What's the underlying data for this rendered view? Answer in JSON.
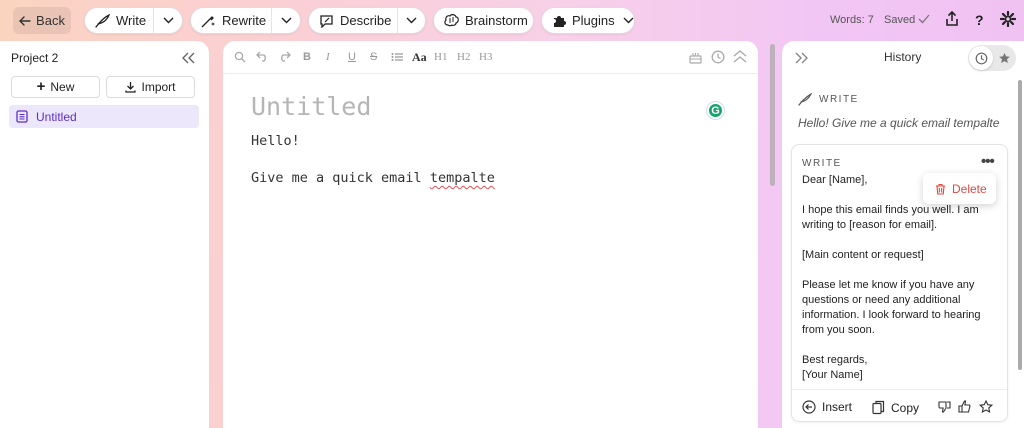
{
  "topbar": {
    "back_label": "Back",
    "write_label": "Write",
    "rewrite_label": "Rewrite",
    "describe_label": "Describe",
    "brainstorm_label": "Brainstorm",
    "plugins_label": "Plugins",
    "word_count": "Words: 7",
    "saved_label": "Saved"
  },
  "sidebar": {
    "project_name": "Project 2",
    "new_label": "New",
    "import_label": "Import",
    "documents": [
      {
        "label": "Untitled",
        "selected": true
      }
    ]
  },
  "editor": {
    "toolbar": {
      "headings": [
        "H1",
        "H2",
        "H3"
      ],
      "font_label": "Aa",
      "bold": "B",
      "italic": "I",
      "underline": "U",
      "strike": "S"
    },
    "title_placeholder": "Untitled",
    "paragraphs": [
      "Hello!",
      "Give me a quick email "
    ],
    "misspelled_word": "tempalte",
    "grammarly_badge": "G"
  },
  "history": {
    "title": "History",
    "entry": {
      "tag": "WRITE",
      "prompt": "Hello! Give me a quick email tempalte"
    },
    "card": {
      "tag": "WRITE",
      "lines": [
        "Dear [Name],",
        "",
        "I hope this email finds you well. I am writing to [reason for email].",
        "",
        "[Main content or request]",
        "",
        "Please let me know if you have any questions or need any additional information. I look forward to hearing from you soon.",
        "",
        "Best regards,",
        "[Your Name]"
      ],
      "delete_label": "Delete",
      "insert_label": "Insert",
      "copy_label": "Copy"
    }
  },
  "colors": {
    "accent": "#5b2fc9",
    "selected_bg": "#ede7fb",
    "danger": "#e0483e",
    "grammarly": "#15a46a"
  }
}
